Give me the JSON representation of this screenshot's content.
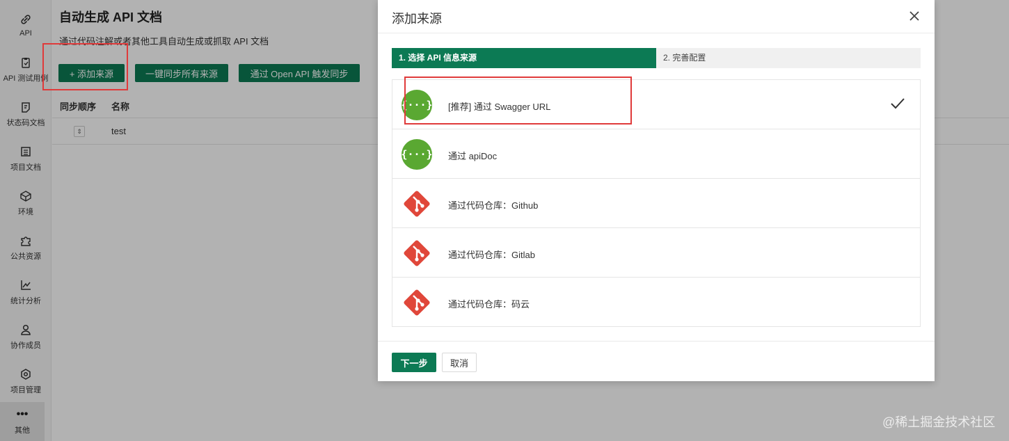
{
  "sidebar": {
    "items": [
      {
        "label": "API",
        "icon": "link-icon"
      },
      {
        "label": "API 测试用例",
        "icon": "clipboard-icon"
      },
      {
        "label": "状态码文档",
        "icon": "doc-icon"
      },
      {
        "label": "项目文档",
        "icon": "list-icon"
      },
      {
        "label": "环境",
        "icon": "cube-icon"
      },
      {
        "label": "公共资源",
        "icon": "puzzle-icon"
      },
      {
        "label": "统计分析",
        "icon": "chart-icon"
      },
      {
        "label": "协作成员",
        "icon": "user-icon"
      },
      {
        "label": "项目管理",
        "icon": "gear-icon"
      },
      {
        "label": "其他",
        "icon": "more-icon"
      }
    ]
  },
  "page": {
    "title": "自动生成 API 文档",
    "description": "通过代码注解或者其他工具自动生成或抓取 API 文档",
    "buttons": {
      "add_source": "+ 添加来源",
      "sync_all": "一键同步所有来源",
      "openapi_sync": "通过 Open API 触发同步"
    },
    "table": {
      "columns": [
        "同步顺序",
        "名称"
      ],
      "rows": [
        {
          "name": "test"
        }
      ]
    }
  },
  "modal": {
    "title": "添加来源",
    "steps": [
      "1. 选择 API 信息来源",
      "2. 完善配置"
    ],
    "options": [
      {
        "label": "[推荐] 通过 Swagger URL",
        "icon": "swagger-icon",
        "selected": true
      },
      {
        "label": "通过 apiDoc",
        "icon": "swagger-icon",
        "selected": false
      },
      {
        "label": "通过代码仓库：Github",
        "icon": "git-icon",
        "selected": false
      },
      {
        "label": "通过代码仓库：Gitlab",
        "icon": "git-icon",
        "selected": false
      },
      {
        "label": "通过代码仓库：码云",
        "icon": "git-icon",
        "selected": false
      }
    ],
    "next_label": "下一步",
    "cancel_label": "取消"
  },
  "watermark": "@稀土掘金技术社区",
  "colors": {
    "accent": "#0c7a54",
    "swagger_green": "#5aa832",
    "git_red": "#e0473a",
    "annotation": "#e03a3a"
  }
}
